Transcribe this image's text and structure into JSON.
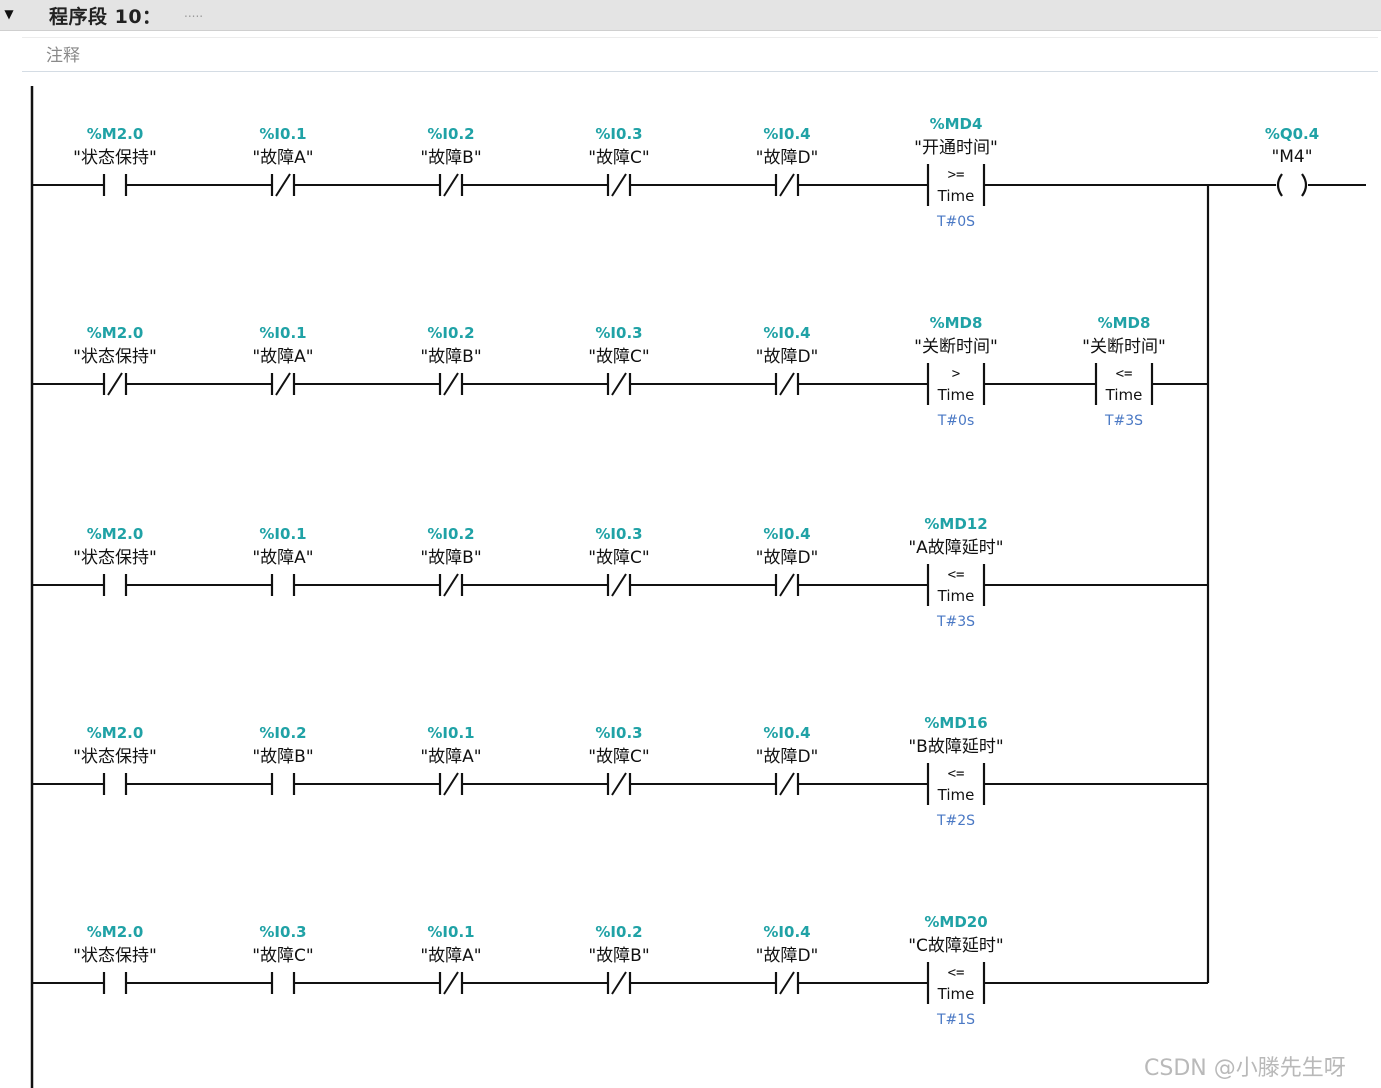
{
  "network": {
    "title": "程序段 10：",
    "title_dots": ".....",
    "comment": "注释"
  },
  "rungs": [
    {
      "contacts": [
        {
          "addr": "%M2.0",
          "tag": "\"状态保持\"",
          "type": "NO"
        },
        {
          "addr": "%I0.1",
          "tag": "\"故障A\"",
          "type": "NC"
        },
        {
          "addr": "%I0.2",
          "tag": "\"故障B\"",
          "type": "NC"
        },
        {
          "addr": "%I0.3",
          "tag": "\"故障C\"",
          "type": "NC"
        },
        {
          "addr": "%I0.4",
          "tag": "\"故障D\"",
          "type": "NC"
        }
      ],
      "compares": [
        {
          "addr": "%MD4",
          "tag": "\"开通时间\"",
          "op": ">=",
          "dtype": "Time",
          "value": "T#0S"
        }
      ]
    },
    {
      "contacts": [
        {
          "addr": "%M2.0",
          "tag": "\"状态保持\"",
          "type": "NC"
        },
        {
          "addr": "%I0.1",
          "tag": "\"故障A\"",
          "type": "NC"
        },
        {
          "addr": "%I0.2",
          "tag": "\"故障B\"",
          "type": "NC"
        },
        {
          "addr": "%I0.3",
          "tag": "\"故障C\"",
          "type": "NC"
        },
        {
          "addr": "%I0.4",
          "tag": "\"故障D\"",
          "type": "NC"
        }
      ],
      "compares": [
        {
          "addr": "%MD8",
          "tag": "\"关断时间\"",
          "op": ">",
          "dtype": "Time",
          "value": "T#0s"
        },
        {
          "addr": "%MD8",
          "tag": "\"关断时间\"",
          "op": "<=",
          "dtype": "Time",
          "value": "T#3S"
        }
      ]
    },
    {
      "contacts": [
        {
          "addr": "%M2.0",
          "tag": "\"状态保持\"",
          "type": "NO"
        },
        {
          "addr": "%I0.1",
          "tag": "\"故障A\"",
          "type": "NO"
        },
        {
          "addr": "%I0.2",
          "tag": "\"故障B\"",
          "type": "NC"
        },
        {
          "addr": "%I0.3",
          "tag": "\"故障C\"",
          "type": "NC"
        },
        {
          "addr": "%I0.4",
          "tag": "\"故障D\"",
          "type": "NC"
        }
      ],
      "compares": [
        {
          "addr": "%MD12",
          "tag": "\"A故障延时\"",
          "op": "<=",
          "dtype": "Time",
          "value": "T#3S"
        }
      ]
    },
    {
      "contacts": [
        {
          "addr": "%M2.0",
          "tag": "\"状态保持\"",
          "type": "NO"
        },
        {
          "addr": "%I0.2",
          "tag": "\"故障B\"",
          "type": "NO"
        },
        {
          "addr": "%I0.1",
          "tag": "\"故障A\"",
          "type": "NC"
        },
        {
          "addr": "%I0.3",
          "tag": "\"故障C\"",
          "type": "NC"
        },
        {
          "addr": "%I0.4",
          "tag": "\"故障D\"",
          "type": "NC"
        }
      ],
      "compares": [
        {
          "addr": "%MD16",
          "tag": "\"B故障延时\"",
          "op": "<=",
          "dtype": "Time",
          "value": "T#2S"
        }
      ]
    },
    {
      "contacts": [
        {
          "addr": "%M2.0",
          "tag": "\"状态保持\"",
          "type": "NO"
        },
        {
          "addr": "%I0.3",
          "tag": "\"故障C\"",
          "type": "NO"
        },
        {
          "addr": "%I0.1",
          "tag": "\"故障A\"",
          "type": "NC"
        },
        {
          "addr": "%I0.2",
          "tag": "\"故障B\"",
          "type": "NC"
        },
        {
          "addr": "%I0.4",
          "tag": "\"故障D\"",
          "type": "NC"
        }
      ],
      "compares": [
        {
          "addr": "%MD20",
          "tag": "\"C故障延时\"",
          "op": "<=",
          "dtype": "Time",
          "value": "T#1S"
        }
      ]
    }
  ],
  "coil": {
    "addr": "%Q0.4",
    "tag": "\"M4\""
  },
  "watermark": "CSDN @小滕先生呀"
}
